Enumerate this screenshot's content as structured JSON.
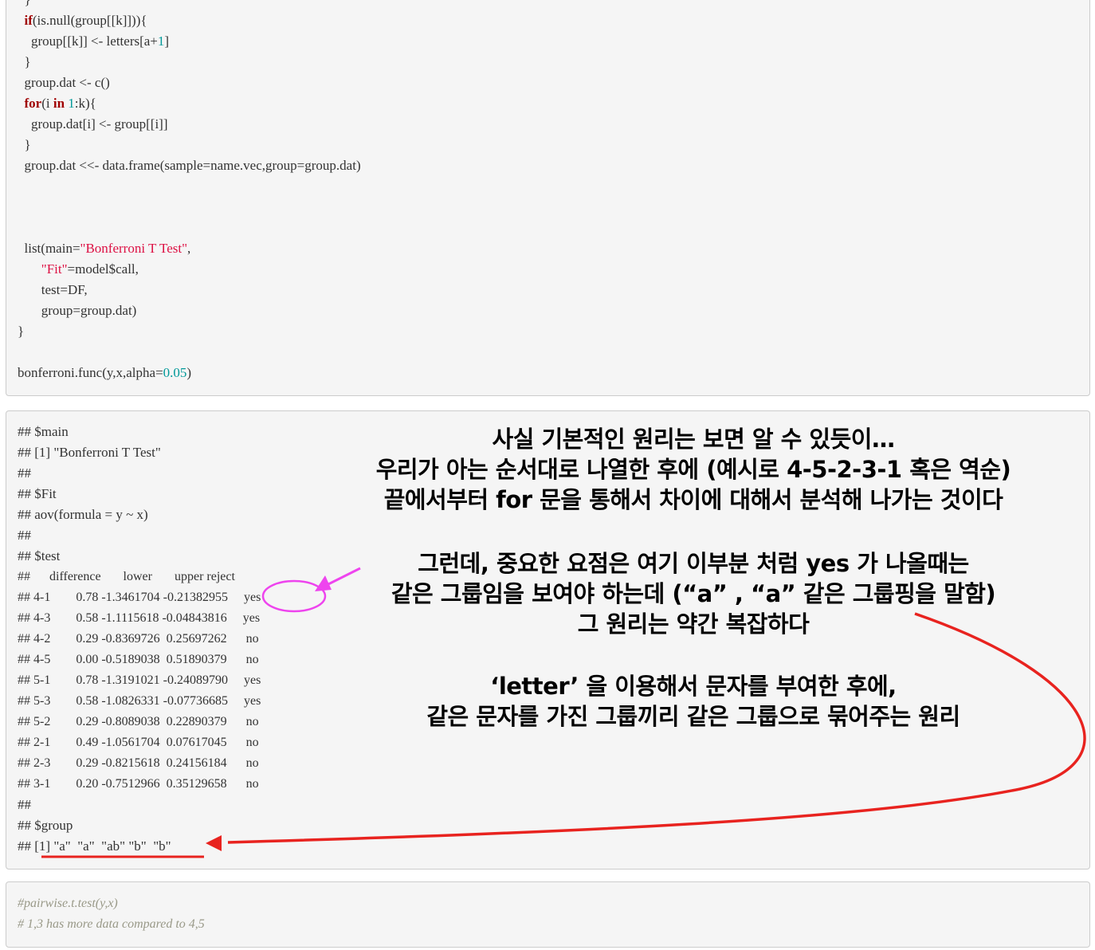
{
  "code_block_1": {
    "lines": [
      "  }",
      "  if(is.null(group[[k]])){",
      "    group[[k]] <- letters[a+1]",
      "  }",
      "  group.dat <- c()",
      "  for(i in 1:k){",
      "    group.dat[i] <- group[[i]]",
      "  }",
      "  group.dat <<- data.frame(sample=name.vec,group=group.dat)",
      "  list(main=\"Bonferroni T Test\",",
      "       \"Fit\"=model$call,",
      "       test=DF,",
      "       group=group.dat)",
      "}",
      "bonferroni.func(y,x,alpha=0.05)"
    ],
    "tokens": {
      "if_kw": "if",
      "if_rest": "(is.null(group[[k]])){",
      "letters_pre": "    group[[k]] <- letters[a+",
      "letters_num": "1",
      "letters_post": "]",
      "for_kw": "for",
      "for_paren": "(i ",
      "in_kw": "in",
      "for_sp": " ",
      "for_num": "1",
      "for_rest": ":k){",
      "list_pre": "  list(main=",
      "list_str": "\"Bonferroni T Test\"",
      "list_post": ",",
      "fit_pre": "       ",
      "fit_str": "\"Fit\"",
      "fit_post": "=model$call,",
      "bonf_pre": "bonferroni.func(y,x,alpha=",
      "bonf_num": "0.05",
      "bonf_post": ")"
    }
  },
  "output_block": {
    "lines": [
      "## $main",
      "## [1] \"Bonferroni T Test\"",
      "##",
      "## $Fit",
      "## aov(formula = y ~ x)",
      "##",
      "## $test",
      "##      difference       lower       upper reject",
      "## 4-1        0.78 -1.3461704 -0.21382955     yes",
      "## 4-3        0.58 -1.1115618 -0.04843816     yes",
      "## 4-2        0.29 -0.8369726  0.25697262      no",
      "## 4-5        0.00 -0.5189038  0.51890379      no",
      "## 5-1        0.78 -1.3191021 -0.24089790     yes",
      "## 5-3        0.58 -1.0826331 -0.07736685     yes",
      "## 5-2        0.29 -0.8089038  0.22890379      no",
      "## 2-1        0.49 -1.0561704  0.07617045      no",
      "## 2-3        0.29 -0.8215618  0.24156184      no",
      "## 3-1        0.20 -0.7512966  0.35129658      no",
      "##",
      "## $group",
      "## [1] \"a\"  \"a\"  \"ab\" \"b\"  \"b\""
    ]
  },
  "annotations": {
    "para1": [
      "사실 기본적인 원리는 보면 알 수 있듯이…",
      "우리가 아는 순서대로 나열한 후에 (예시로 4-5-2-3-1 혹은 역순)",
      "끝에서부터 for 문을 통해서 차이에 대해서 분석해 나가는 것이다"
    ],
    "para2": [
      "그런데, 중요한 요점은 여기 이부분 처럼 yes 가 나올때는",
      "같은 그룹임을 보여야 하는데 (“a” , “a” 같은 그룹핑을 말함)",
      "그 원리는 약간 복잡하다"
    ],
    "para3": [
      "‘letter’ 을 이용해서 문자를 부여한 후에,",
      "같은 문자를 가진 그룹끼리 같은 그룹으로 묶어주는 원리"
    ]
  },
  "comment_block": {
    "lines": [
      "#pairwise.t.test(y,x)",
      "# 1,3 has more data compared to 4,5"
    ]
  },
  "colors": {
    "keyword": "#a00000",
    "number": "#009999",
    "string": "#dd1144",
    "comment": "#999988",
    "magenta_markup": "#ee44ee",
    "red_markup": "#e8231f"
  }
}
